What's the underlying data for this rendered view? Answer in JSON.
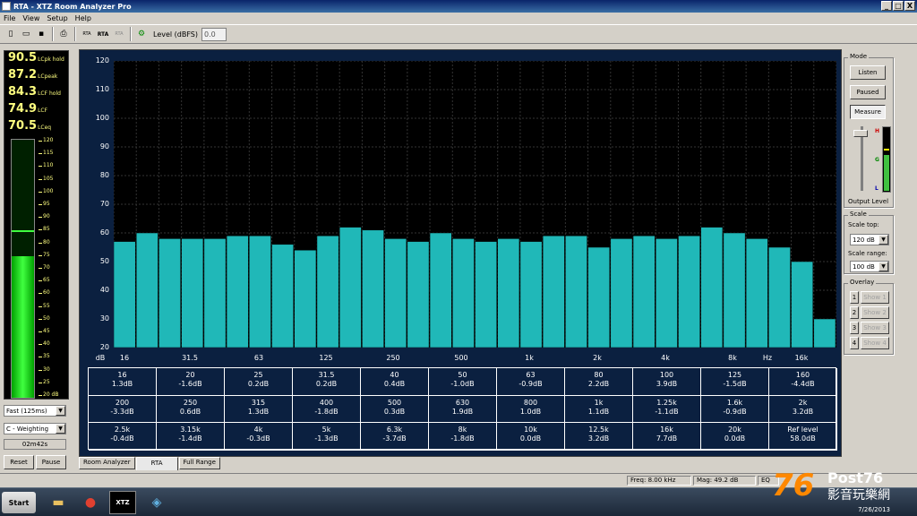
{
  "window": {
    "title": "RTA - XTZ Room Analyzer Pro",
    "btn_min": "_",
    "btn_max": "□",
    "btn_close": "X"
  },
  "menu": [
    "File",
    "View",
    "Setup",
    "Help"
  ],
  "toolbar": {
    "rta1": "RTA",
    "rta2": "RTA",
    "rta3": "RTA",
    "level_label": "Level (dBFS)",
    "level_value": "0.0"
  },
  "readouts": [
    {
      "value": "90.5",
      "label": "LCpk hold"
    },
    {
      "value": "87.2",
      "label": "LCpeak"
    },
    {
      "value": "84.3",
      "label": "LCF hold"
    },
    {
      "value": "74.9",
      "label": "LCF"
    },
    {
      "value": "70.5",
      "label": "LCeq"
    }
  ],
  "meter": {
    "level": 74.9,
    "hold": 84.3,
    "min": 20,
    "max": 120,
    "scale": [
      "120",
      "115",
      "110",
      "105",
      "100",
      "95",
      "90",
      "85",
      "80",
      "75",
      "70",
      "65",
      "60",
      "55",
      "50",
      "45",
      "40",
      "35",
      "30",
      "25",
      "20 dB"
    ]
  },
  "left_controls": {
    "speed": "Fast (125ms)",
    "weighting": "C - Weighting",
    "elapsed": "02m42s",
    "reset": "Reset",
    "pause": "Pause"
  },
  "chart_data": {
    "type": "bar",
    "ylim": [
      20,
      120
    ],
    "yticks": [
      "120",
      "110",
      "100",
      "90",
      "80",
      "70",
      "60",
      "50",
      "40",
      "30",
      "20"
    ],
    "x_tick_labels": [
      "dB",
      "16",
      "31.5",
      "63",
      "125",
      "250",
      "500",
      "1k",
      "2k",
      "4k",
      "8k",
      "Hz",
      "16k"
    ],
    "bar_values": [
      57,
      60,
      58,
      58,
      58,
      59,
      59,
      56,
      54,
      59,
      62,
      61,
      58,
      57,
      60,
      58,
      57,
      58,
      57,
      59,
      59,
      55,
      58,
      59,
      58,
      59,
      62,
      60,
      58,
      55,
      50,
      30
    ],
    "bar_color": "#20b8b8"
  },
  "table": [
    [
      "16",
      "1.3dB"
    ],
    [
      "20",
      "-1.6dB"
    ],
    [
      "25",
      "0.2dB"
    ],
    [
      "31.5",
      "0.2dB"
    ],
    [
      "40",
      "0.4dB"
    ],
    [
      "50",
      "-1.0dB"
    ],
    [
      "63",
      "-0.9dB"
    ],
    [
      "80",
      "2.2dB"
    ],
    [
      "100",
      "3.9dB"
    ],
    [
      "125",
      "-1.5dB"
    ],
    [
      "160",
      "-4.4dB"
    ],
    [
      "200",
      "-3.3dB"
    ],
    [
      "250",
      "0.6dB"
    ],
    [
      "315",
      "1.3dB"
    ],
    [
      "400",
      "-1.8dB"
    ],
    [
      "500",
      "0.3dB"
    ],
    [
      "630",
      "1.9dB"
    ],
    [
      "800",
      "1.0dB"
    ],
    [
      "1k",
      "1.1dB"
    ],
    [
      "1.25k",
      "-1.1dB"
    ],
    [
      "1.6k",
      "-0.9dB"
    ],
    [
      "2k",
      "3.2dB"
    ],
    [
      "2.5k",
      "-0.4dB"
    ],
    [
      "3.15k",
      "-1.4dB"
    ],
    [
      "4k",
      "-0.3dB"
    ],
    [
      "5k",
      "-1.3dB"
    ],
    [
      "6.3k",
      "-3.7dB"
    ],
    [
      "8k",
      "-1.8dB"
    ],
    [
      "10k",
      "0.0dB"
    ],
    [
      "12.5k",
      "3.2dB"
    ],
    [
      "16k",
      "7.7dB"
    ],
    [
      "20k",
      "0.0dB"
    ],
    [
      "Ref level",
      "58.0dB"
    ]
  ],
  "tabs": [
    "Room Analyzer",
    "RTA",
    "Full Range"
  ],
  "mode": {
    "label": "Mode",
    "listen": "Listen",
    "paused": "Paused",
    "measure": "Measure",
    "output_level": "Output Level",
    "h": "H",
    "g": "G",
    "l": "L"
  },
  "scale": {
    "label": "Scale",
    "top_label": "Scale top:",
    "top_value": "120 dB",
    "range_label": "Scale range:",
    "range_value": "100 dB"
  },
  "overlay": {
    "label": "Overlay",
    "items": [
      {
        "n": "1",
        "b": "Show 1"
      },
      {
        "n": "2",
        "b": "Show 2"
      },
      {
        "n": "3",
        "b": "Show 3"
      },
      {
        "n": "4",
        "b": "Show 4"
      }
    ]
  },
  "status": {
    "freq": "Freq: 8.00 kHz",
    "mag": "Mag: 49.2 dB",
    "eq": "EQ"
  },
  "taskbar": {
    "start": "Start",
    "xtz": "XTZ",
    "date": "7/26/2013"
  },
  "watermark": {
    "num": "76",
    "post": "Post76",
    "cn": "影音玩樂網"
  }
}
